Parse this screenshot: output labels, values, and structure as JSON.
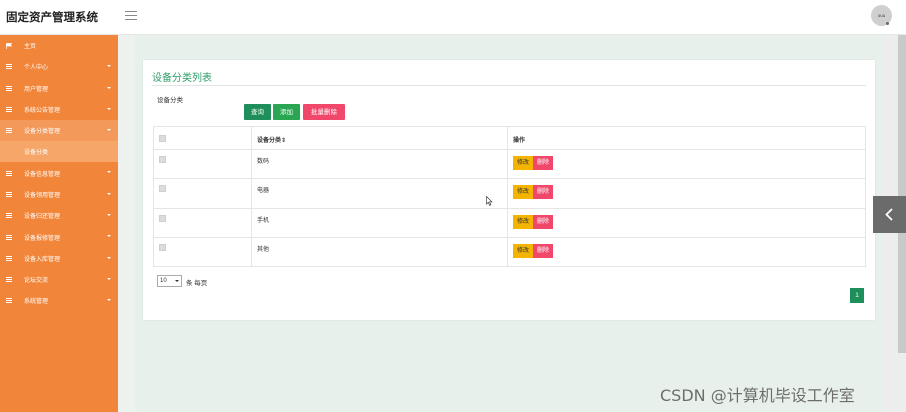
{
  "header": {
    "app_title": "固定资产管理系统",
    "avatar_text": "ouu"
  },
  "sidebar": {
    "items": [
      {
        "label": "主页",
        "icon": "flag-icon",
        "has_caret": false
      },
      {
        "label": "个人中心",
        "icon": "list-icon",
        "has_caret": true
      },
      {
        "label": "用户管理",
        "icon": "list-icon",
        "has_caret": true
      },
      {
        "label": "系统公告管理",
        "icon": "list-icon",
        "has_caret": true
      },
      {
        "label": "设备分类管理",
        "icon": "list-icon",
        "has_caret": true,
        "open": true
      },
      {
        "label": "设备信息管理",
        "icon": "list-icon",
        "has_caret": true
      },
      {
        "label": "设备领用管理",
        "icon": "list-icon",
        "has_caret": true
      },
      {
        "label": "设备归还管理",
        "icon": "list-icon",
        "has_caret": true
      },
      {
        "label": "设备报修管理",
        "icon": "list-icon",
        "has_caret": true
      },
      {
        "label": "设备入库管理",
        "icon": "list-icon",
        "has_caret": true
      },
      {
        "label": "论坛交流",
        "icon": "list-icon",
        "has_caret": true
      },
      {
        "label": "系统管理",
        "icon": "list-icon",
        "has_caret": true
      }
    ],
    "submenu": {
      "label": "设备分类"
    }
  },
  "main": {
    "title": "设备分类列表",
    "search": {
      "label": "设备分类",
      "value": "",
      "placeholder": ""
    },
    "buttons": {
      "query": "查询",
      "add": "添加",
      "batch_delete": "批量删除"
    },
    "table": {
      "headers": {
        "name": "设备分类⇕",
        "actions": "操作"
      },
      "rows": [
        {
          "name": "数码"
        },
        {
          "name": "电器"
        },
        {
          "name": "手机"
        },
        {
          "name": "其他"
        }
      ],
      "edit_label": "修改",
      "delete_label": "删除"
    },
    "pager": {
      "page_size": "10",
      "per_page_text": "条 每页",
      "current_page": "1"
    }
  },
  "watermark": "CSDN @计算机毕设工作室",
  "colors": {
    "sidebar": "#f1863b",
    "title_green": "#2f9d6a",
    "primary_green": "#1e8f5a",
    "danger": "#f0476a",
    "warning": "#f5b400"
  }
}
